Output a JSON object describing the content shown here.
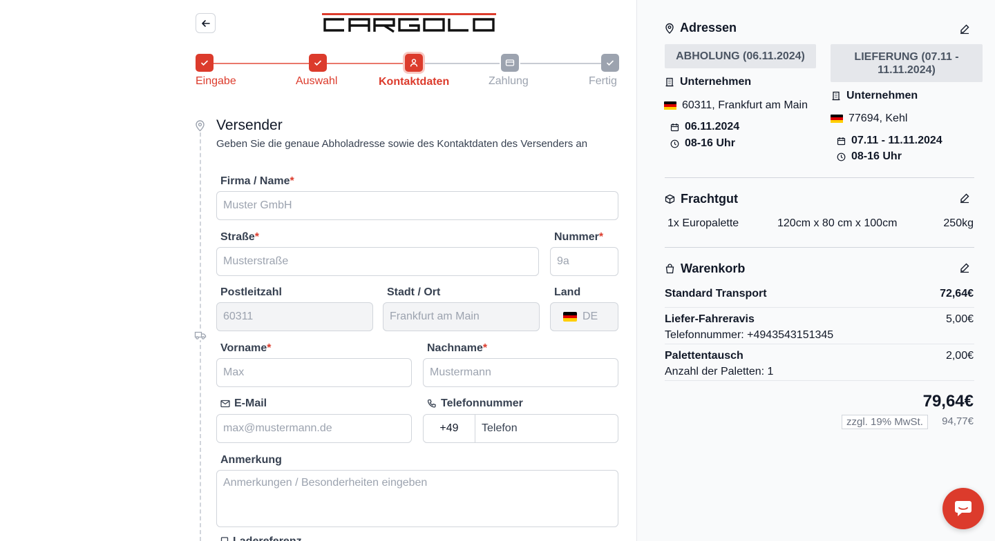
{
  "brand": {
    "logo_text": "CARGOLO",
    "accent": "#dc3b2c"
  },
  "stepper": {
    "steps": [
      {
        "label": "Eingabe",
        "state": "done",
        "icon": "check-icon"
      },
      {
        "label": "Auswahl",
        "state": "done",
        "icon": "check-icon"
      },
      {
        "label": "Kontaktdaten",
        "state": "active",
        "icon": "user-icon"
      },
      {
        "label": "Zahlung",
        "state": "todo",
        "icon": "credit-card-icon"
      },
      {
        "label": "Fertig",
        "state": "todo",
        "icon": "check-icon"
      }
    ]
  },
  "sender": {
    "title": "Versender",
    "description": "Geben Sie die genaue Abholadresse sowie des Kontaktdaten des Versenders an",
    "fields": {
      "company": {
        "label": "Firma / Name",
        "placeholder": "Muster GmbH",
        "required": true
      },
      "street": {
        "label": "Straße",
        "placeholder": "Musterstraße",
        "required": true
      },
      "number": {
        "label": "Nummer",
        "placeholder": "9a",
        "required": true
      },
      "zip": {
        "label": "Postleitzahl",
        "value": "60311"
      },
      "city": {
        "label": "Stadt / Ort",
        "value": "Frankfurt am Main"
      },
      "country": {
        "label": "Land",
        "value": "DE"
      },
      "firstname": {
        "label": "Vorname",
        "placeholder": "Max",
        "required": true
      },
      "lastname": {
        "label": "Nachname",
        "placeholder": "Mustermann",
        "required": true
      },
      "email": {
        "label": "E-Mail",
        "placeholder": "max@mustermann.de"
      },
      "phone": {
        "label": "Telefonnummer",
        "prefix": "+49",
        "placeholder": "Telefon"
      },
      "note": {
        "label": "Anmerkung",
        "placeholder": "Anmerkungen / Besonderheiten eingeben"
      },
      "loading_ref": {
        "label": "Ladereferenz"
      }
    },
    "required_mark": "*"
  },
  "summary": {
    "addresses": {
      "title": "Adressen",
      "pickup": {
        "badge": "ABHOLUNG (06.11.2024)",
        "type": "Unternehmen",
        "location": "60311, Frankfurt am Main",
        "date": "06.11.2024",
        "time": "08-16 Uhr"
      },
      "delivery": {
        "badge_line1": "LIEFERUNG (07.11 -",
        "badge_line2": "11.11.2024)",
        "type": "Unternehmen",
        "location": "77694, Kehl",
        "date": "07.11 - 11.11.2024",
        "time": "08-16 Uhr"
      }
    },
    "freight": {
      "title": "Frachtgut",
      "item": "1x Europalette",
      "dimensions": "120cm x 80 cm x 100cm",
      "weight": "250kg"
    },
    "cart": {
      "title": "Warenkorb",
      "lines": [
        {
          "name": "Standard Transport",
          "price": "72,64€",
          "detail": ""
        },
        {
          "name": "Liefer-Fahreravis",
          "price": "5,00€",
          "detail": "Telefonnummer: +4943543151345"
        },
        {
          "name": "Palettentausch",
          "price": "2,00€",
          "detail": "Anzahl der Paletten: 1"
        }
      ],
      "total": "79,64€",
      "vat_label": "zzgl. 19% MwSt.",
      "gross": "94,77€"
    }
  }
}
